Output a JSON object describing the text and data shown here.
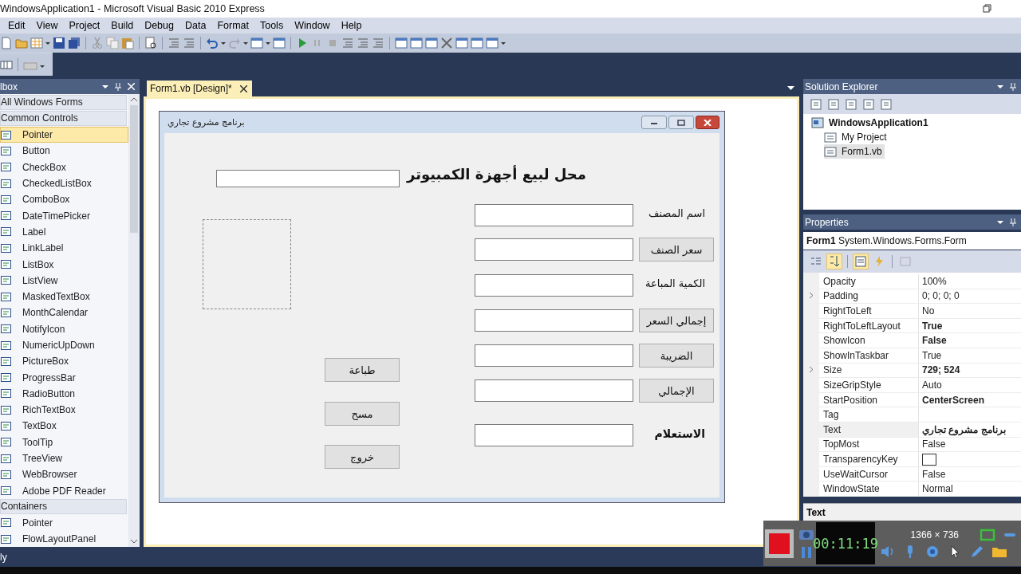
{
  "window": {
    "title": "WindowsApplication1 - Microsoft Visual Basic 2010 Express"
  },
  "menu": [
    "Edit",
    "View",
    "Project",
    "Build",
    "Debug",
    "Data",
    "Format",
    "Tools",
    "Window",
    "Help"
  ],
  "toolbox": {
    "title": "lbox",
    "groups": [
      {
        "label": "All Windows Forms"
      },
      {
        "label": "Common Controls",
        "items": [
          {
            "label": "Pointer",
            "selected": true
          },
          {
            "label": "Button",
            "selected": false
          },
          {
            "label": "CheckBox",
            "selected": false
          },
          {
            "label": "CheckedListBox",
            "selected": false
          },
          {
            "label": "ComboBox",
            "selected": false
          },
          {
            "label": "DateTimePicker",
            "selected": false
          },
          {
            "label": "Label",
            "selected": false
          },
          {
            "label": "LinkLabel",
            "selected": false
          },
          {
            "label": "ListBox",
            "selected": false
          },
          {
            "label": "ListView",
            "selected": false
          },
          {
            "label": "MaskedTextBox",
            "selected": false
          },
          {
            "label": "MonthCalendar",
            "selected": false
          },
          {
            "label": "NotifyIcon",
            "selected": false
          },
          {
            "label": "NumericUpDown",
            "selected": false
          },
          {
            "label": "PictureBox",
            "selected": false
          },
          {
            "label": "ProgressBar",
            "selected": false
          },
          {
            "label": "RadioButton",
            "selected": false
          },
          {
            "label": "RichTextBox",
            "selected": false
          },
          {
            "label": "TextBox",
            "selected": false
          },
          {
            "label": "ToolTip",
            "selected": false
          },
          {
            "label": "TreeView",
            "selected": false
          },
          {
            "label": "WebBrowser",
            "selected": false
          },
          {
            "label": "Adobe PDF Reader",
            "selected": false
          }
        ]
      },
      {
        "label": "Containers",
        "items": [
          {
            "label": "Pointer",
            "selected": false
          },
          {
            "label": "FlowLayoutPanel",
            "selected": false
          }
        ]
      }
    ]
  },
  "editor": {
    "tab": "Form1.vb [Design]*"
  },
  "form": {
    "title": "برنامج مشروع تجاري",
    "heading": "محل لبيع أجهزة الكمبيوتر",
    "rows": [
      {
        "kind": "label",
        "label": "اسم المصنف"
      },
      {
        "kind": "button",
        "label": "سعر الصنف"
      },
      {
        "kind": "label",
        "label": "الكمية المباعة"
      },
      {
        "kind": "button",
        "label": "إجمالي السعر"
      },
      {
        "kind": "button",
        "label": "الضريبة"
      },
      {
        "kind": "button",
        "label": "الإجمالي"
      },
      {
        "kind": "label",
        "label": "الاستعلام"
      }
    ],
    "side_buttons": [
      "طباعة",
      "مسح",
      "خروج"
    ]
  },
  "solution_explorer": {
    "title": "Solution Explorer",
    "tree": [
      {
        "label": "WindowsApplication1",
        "selected": false,
        "children": [
          {
            "label": "My Project",
            "selected": false
          },
          {
            "label": "Form1.vb",
            "selected": true
          }
        ]
      }
    ]
  },
  "properties": {
    "title": "Properties",
    "object": "Form1",
    "type": "System.Windows.Forms.Form",
    "rows": [
      {
        "name": "Opacity",
        "value": "100%",
        "bold": false,
        "expandable": false,
        "selected": false
      },
      {
        "name": "Padding",
        "value": "0; 0; 0; 0",
        "bold": false,
        "expandable": true,
        "selected": false
      },
      {
        "name": "RightToLeft",
        "value": "No",
        "bold": false,
        "expandable": false,
        "selected": false
      },
      {
        "name": "RightToLeftLayout",
        "value": "True",
        "bold": true,
        "expandable": false,
        "selected": false
      },
      {
        "name": "ShowIcon",
        "value": "False",
        "bold": true,
        "expandable": false,
        "selected": false
      },
      {
        "name": "ShowInTaskbar",
        "value": "True",
        "bold": false,
        "expandable": false,
        "selected": false
      },
      {
        "name": "Size",
        "value": "729; 524",
        "bold": true,
        "expandable": true,
        "selected": false
      },
      {
        "name": "SizeGripStyle",
        "value": "Auto",
        "bold": false,
        "expandable": false,
        "selected": false
      },
      {
        "name": "StartPosition",
        "value": "CenterScreen",
        "bold": true,
        "expandable": false,
        "selected": false
      },
      {
        "name": "Tag",
        "expandable": false,
        "selected": false
      },
      {
        "name": "Text",
        "value": "برنامج مشروع تجاري",
        "bold": true,
        "expandable": false,
        "selected": true
      },
      {
        "name": "TopMost",
        "value": "False",
        "bold": false,
        "expandable": false,
        "selected": false
      },
      {
        "name": "TransparencyKey",
        "kind": "swatch",
        "expandable": false,
        "selected": false
      },
      {
        "name": "UseWaitCursor",
        "value": "False",
        "bold": false,
        "expandable": false,
        "selected": false
      },
      {
        "name": "WindowState",
        "value": "Normal",
        "bold": false,
        "expandable": false,
        "selected": false
      }
    ],
    "description_title": "Text"
  },
  "recorder": {
    "timer": "00:11:19",
    "resolution": "1366 × 736"
  },
  "status_bar": "ly"
}
